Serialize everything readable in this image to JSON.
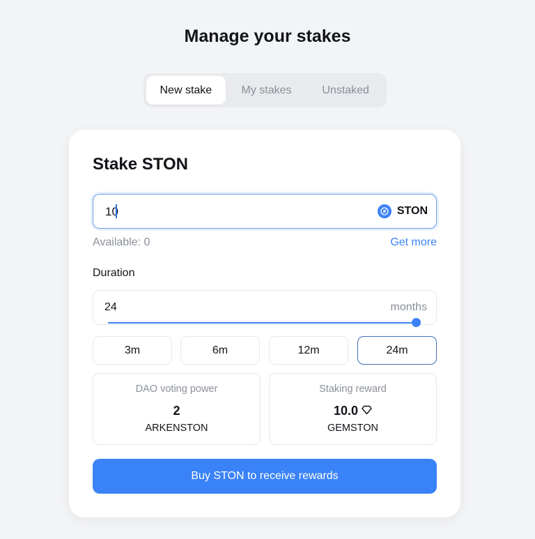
{
  "header": {
    "title": "Manage your stakes"
  },
  "tabs": [
    {
      "label": "New stake",
      "active": true
    },
    {
      "label": "My stakes",
      "active": false
    },
    {
      "label": "Unstaked",
      "active": false
    }
  ],
  "stake_card": {
    "title": "Stake STON",
    "amount": {
      "value": "10",
      "token": "STON",
      "token_icon": "ston-icon"
    },
    "available_label": "Available: 0",
    "get_more_label": "Get more",
    "duration": {
      "label": "Duration",
      "value": "24",
      "unit": "months",
      "slider_fraction": 1.0
    },
    "presets": [
      {
        "label": "3m",
        "selected": false
      },
      {
        "label": "6m",
        "selected": false
      },
      {
        "label": "12m",
        "selected": false
      },
      {
        "label": "24m",
        "selected": true
      }
    ],
    "voting_power": {
      "label": "DAO voting power",
      "value": "2",
      "unit": "ARKENSTON"
    },
    "staking_reward": {
      "label": "Staking reward",
      "value": "10.0",
      "icon": "gem-icon",
      "unit": "GEMSTON"
    },
    "buy_button_label": "Buy STON to receive rewards"
  },
  "colors": {
    "accent": "#3a82f7",
    "background": "#f3f4f6",
    "card": "#ffffff"
  }
}
